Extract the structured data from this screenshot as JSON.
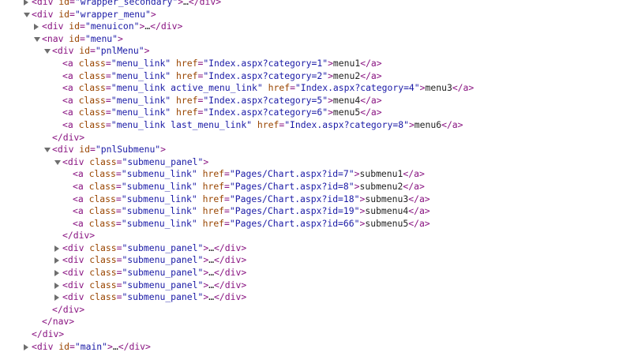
{
  "lines": [
    {
      "depth": 0,
      "toggle": "right",
      "parts": [
        {
          "t": "tag",
          "v": "<div "
        },
        {
          "t": "an",
          "v": "id"
        },
        {
          "t": "tag",
          "v": "="
        },
        {
          "t": "av",
          "v": "\"wrapper_secondary\""
        },
        {
          "t": "tag",
          "v": ">"
        },
        {
          "t": "ell",
          "v": "…"
        },
        {
          "t": "tag",
          "v": "</div>"
        }
      ]
    },
    {
      "depth": 0,
      "toggle": "down",
      "parts": [
        {
          "t": "tag",
          "v": "<div "
        },
        {
          "t": "an",
          "v": "id"
        },
        {
          "t": "tag",
          "v": "="
        },
        {
          "t": "av",
          "v": "\"wrapper_menu\""
        },
        {
          "t": "tag",
          "v": ">"
        }
      ]
    },
    {
      "depth": 1,
      "toggle": "right",
      "parts": [
        {
          "t": "tag",
          "v": "<div "
        },
        {
          "t": "an",
          "v": "id"
        },
        {
          "t": "tag",
          "v": "="
        },
        {
          "t": "av",
          "v": "\"menuicon\""
        },
        {
          "t": "tag",
          "v": ">"
        },
        {
          "t": "ell",
          "v": "…"
        },
        {
          "t": "tag",
          "v": "</div>"
        }
      ]
    },
    {
      "depth": 1,
      "toggle": "down",
      "parts": [
        {
          "t": "tag",
          "v": "<nav "
        },
        {
          "t": "an",
          "v": "id"
        },
        {
          "t": "tag",
          "v": "="
        },
        {
          "t": "av",
          "v": "\"menu\""
        },
        {
          "t": "tag",
          "v": ">"
        }
      ]
    },
    {
      "depth": 2,
      "toggle": "down",
      "parts": [
        {
          "t": "tag",
          "v": "<div "
        },
        {
          "t": "an",
          "v": "id"
        },
        {
          "t": "tag",
          "v": "="
        },
        {
          "t": "av",
          "v": "\"pnlMenu\""
        },
        {
          "t": "tag",
          "v": ">"
        }
      ]
    },
    {
      "depth": 3,
      "toggle": "none",
      "parts": [
        {
          "t": "tag",
          "v": "<a "
        },
        {
          "t": "an",
          "v": "class"
        },
        {
          "t": "tag",
          "v": "="
        },
        {
          "t": "av",
          "v": "\"menu_link\""
        },
        {
          "t": "tag",
          "v": " "
        },
        {
          "t": "an",
          "v": "href"
        },
        {
          "t": "tag",
          "v": "="
        },
        {
          "t": "avl",
          "v": "\"Index.aspx?category=1\""
        },
        {
          "t": "tag",
          "v": ">"
        },
        {
          "t": "txt",
          "v": "menu1"
        },
        {
          "t": "tag",
          "v": "</a>"
        }
      ]
    },
    {
      "depth": 3,
      "toggle": "none",
      "parts": [
        {
          "t": "tag",
          "v": "<a "
        },
        {
          "t": "an",
          "v": "class"
        },
        {
          "t": "tag",
          "v": "="
        },
        {
          "t": "av",
          "v": "\"menu_link\""
        },
        {
          "t": "tag",
          "v": " "
        },
        {
          "t": "an",
          "v": "href"
        },
        {
          "t": "tag",
          "v": "="
        },
        {
          "t": "avl",
          "v": "\"Index.aspx?category=2\""
        },
        {
          "t": "tag",
          "v": ">"
        },
        {
          "t": "txt",
          "v": "menu2"
        },
        {
          "t": "tag",
          "v": "</a>"
        }
      ]
    },
    {
      "depth": 3,
      "toggle": "none",
      "parts": [
        {
          "t": "tag",
          "v": "<a "
        },
        {
          "t": "an",
          "v": "class"
        },
        {
          "t": "tag",
          "v": "="
        },
        {
          "t": "av",
          "v": "\"menu_link active_menu_link\""
        },
        {
          "t": "tag",
          "v": " "
        },
        {
          "t": "an",
          "v": "href"
        },
        {
          "t": "tag",
          "v": "="
        },
        {
          "t": "avl",
          "v": "\"Index.aspx?category=4\""
        },
        {
          "t": "tag",
          "v": ">"
        },
        {
          "t": "txt",
          "v": "menu3"
        },
        {
          "t": "tag",
          "v": "</a>"
        }
      ]
    },
    {
      "depth": 3,
      "toggle": "none",
      "parts": [
        {
          "t": "tag",
          "v": "<a "
        },
        {
          "t": "an",
          "v": "class"
        },
        {
          "t": "tag",
          "v": "="
        },
        {
          "t": "av",
          "v": "\"menu_link\""
        },
        {
          "t": "tag",
          "v": " "
        },
        {
          "t": "an",
          "v": "href"
        },
        {
          "t": "tag",
          "v": "="
        },
        {
          "t": "avl",
          "v": "\"Index.aspx?category=5\""
        },
        {
          "t": "tag",
          "v": ">"
        },
        {
          "t": "txt",
          "v": "menu4"
        },
        {
          "t": "tag",
          "v": "</a>"
        }
      ]
    },
    {
      "depth": 3,
      "toggle": "none",
      "parts": [
        {
          "t": "tag",
          "v": "<a "
        },
        {
          "t": "an",
          "v": "class"
        },
        {
          "t": "tag",
          "v": "="
        },
        {
          "t": "av",
          "v": "\"menu_link\""
        },
        {
          "t": "tag",
          "v": " "
        },
        {
          "t": "an",
          "v": "href"
        },
        {
          "t": "tag",
          "v": "="
        },
        {
          "t": "avl",
          "v": "\"Index.aspx?category=6\""
        },
        {
          "t": "tag",
          "v": ">"
        },
        {
          "t": "txt",
          "v": "menu5"
        },
        {
          "t": "tag",
          "v": "</a>"
        }
      ]
    },
    {
      "depth": 3,
      "toggle": "none",
      "parts": [
        {
          "t": "tag",
          "v": "<a "
        },
        {
          "t": "an",
          "v": "class"
        },
        {
          "t": "tag",
          "v": "="
        },
        {
          "t": "av",
          "v": "\"menu_link last_menu_link\""
        },
        {
          "t": "tag",
          "v": " "
        },
        {
          "t": "an",
          "v": "href"
        },
        {
          "t": "tag",
          "v": "="
        },
        {
          "t": "avl",
          "v": "\"Index.aspx?category=8\""
        },
        {
          "t": "tag",
          "v": ">"
        },
        {
          "t": "txt",
          "v": "menu6"
        },
        {
          "t": "tag",
          "v": "</a>"
        }
      ]
    },
    {
      "depth": 2,
      "toggle": "none",
      "parts": [
        {
          "t": "tag",
          "v": "</div>"
        }
      ]
    },
    {
      "depth": 2,
      "toggle": "down",
      "parts": [
        {
          "t": "tag",
          "v": "<div "
        },
        {
          "t": "an",
          "v": "id"
        },
        {
          "t": "tag",
          "v": "="
        },
        {
          "t": "av",
          "v": "\"pnlSubmenu\""
        },
        {
          "t": "tag",
          "v": ">"
        }
      ]
    },
    {
      "depth": 3,
      "toggle": "down",
      "parts": [
        {
          "t": "tag",
          "v": "<div "
        },
        {
          "t": "an",
          "v": "class"
        },
        {
          "t": "tag",
          "v": "="
        },
        {
          "t": "av",
          "v": "\"submenu_panel\""
        },
        {
          "t": "tag",
          "v": ">"
        }
      ]
    },
    {
      "depth": 4,
      "toggle": "none",
      "parts": [
        {
          "t": "tag",
          "v": "<a "
        },
        {
          "t": "an",
          "v": "class"
        },
        {
          "t": "tag",
          "v": "="
        },
        {
          "t": "av",
          "v": "\"submenu_link\""
        },
        {
          "t": "tag",
          "v": " "
        },
        {
          "t": "an",
          "v": "href"
        },
        {
          "t": "tag",
          "v": "="
        },
        {
          "t": "avl",
          "v": "\"Pages/Chart.aspx?id=7\""
        },
        {
          "t": "tag",
          "v": ">"
        },
        {
          "t": "txt",
          "v": "submenu1"
        },
        {
          "t": "tag",
          "v": "</a>"
        }
      ]
    },
    {
      "depth": 4,
      "toggle": "none",
      "parts": [
        {
          "t": "tag",
          "v": "<a "
        },
        {
          "t": "an",
          "v": "class"
        },
        {
          "t": "tag",
          "v": "="
        },
        {
          "t": "av",
          "v": "\"submenu_link\""
        },
        {
          "t": "tag",
          "v": " "
        },
        {
          "t": "an",
          "v": "href"
        },
        {
          "t": "tag",
          "v": "="
        },
        {
          "t": "avl",
          "v": "\"Pages/Chart.aspx?id=8\""
        },
        {
          "t": "tag",
          "v": ">"
        },
        {
          "t": "txt",
          "v": "submenu2"
        },
        {
          "t": "tag",
          "v": "</a>"
        }
      ]
    },
    {
      "depth": 4,
      "toggle": "none",
      "parts": [
        {
          "t": "tag",
          "v": "<a "
        },
        {
          "t": "an",
          "v": "class"
        },
        {
          "t": "tag",
          "v": "="
        },
        {
          "t": "av",
          "v": "\"submenu_link\""
        },
        {
          "t": "tag",
          "v": " "
        },
        {
          "t": "an",
          "v": "href"
        },
        {
          "t": "tag",
          "v": "="
        },
        {
          "t": "avl",
          "v": "\"Pages/Chart.aspx?id=18\""
        },
        {
          "t": "tag",
          "v": ">"
        },
        {
          "t": "txt",
          "v": "submenu3"
        },
        {
          "t": "tag",
          "v": "</a>"
        }
      ]
    },
    {
      "depth": 4,
      "toggle": "none",
      "parts": [
        {
          "t": "tag",
          "v": "<a "
        },
        {
          "t": "an",
          "v": "class"
        },
        {
          "t": "tag",
          "v": "="
        },
        {
          "t": "av",
          "v": "\"submenu_link\""
        },
        {
          "t": "tag",
          "v": " "
        },
        {
          "t": "an",
          "v": "href"
        },
        {
          "t": "tag",
          "v": "="
        },
        {
          "t": "avl",
          "v": "\"Pages/Chart.aspx?id=19\""
        },
        {
          "t": "tag",
          "v": ">"
        },
        {
          "t": "txt",
          "v": "submenu4"
        },
        {
          "t": "tag",
          "v": "</a>"
        }
      ]
    },
    {
      "depth": 4,
      "toggle": "none",
      "parts": [
        {
          "t": "tag",
          "v": "<a "
        },
        {
          "t": "an",
          "v": "class"
        },
        {
          "t": "tag",
          "v": "="
        },
        {
          "t": "av",
          "v": "\"submenu_link\""
        },
        {
          "t": "tag",
          "v": " "
        },
        {
          "t": "an",
          "v": "href"
        },
        {
          "t": "tag",
          "v": "="
        },
        {
          "t": "avl",
          "v": "\"Pages/Chart.aspx?id=66\""
        },
        {
          "t": "tag",
          "v": ">"
        },
        {
          "t": "txt",
          "v": "submenu5"
        },
        {
          "t": "tag",
          "v": "</a>"
        }
      ]
    },
    {
      "depth": 3,
      "toggle": "none",
      "parts": [
        {
          "t": "tag",
          "v": "</div>"
        }
      ]
    },
    {
      "depth": 3,
      "toggle": "right",
      "parts": [
        {
          "t": "tag",
          "v": "<div "
        },
        {
          "t": "an",
          "v": "class"
        },
        {
          "t": "tag",
          "v": "="
        },
        {
          "t": "av",
          "v": "\"submenu_panel\""
        },
        {
          "t": "tag",
          "v": ">"
        },
        {
          "t": "ell",
          "v": "…"
        },
        {
          "t": "tag",
          "v": "</div>"
        }
      ]
    },
    {
      "depth": 3,
      "toggle": "right",
      "parts": [
        {
          "t": "tag",
          "v": "<div "
        },
        {
          "t": "an",
          "v": "class"
        },
        {
          "t": "tag",
          "v": "="
        },
        {
          "t": "av",
          "v": "\"submenu_panel\""
        },
        {
          "t": "tag",
          "v": ">"
        },
        {
          "t": "ell",
          "v": "…"
        },
        {
          "t": "tag",
          "v": "</div>"
        }
      ]
    },
    {
      "depth": 3,
      "toggle": "right",
      "parts": [
        {
          "t": "tag",
          "v": "<div "
        },
        {
          "t": "an",
          "v": "class"
        },
        {
          "t": "tag",
          "v": "="
        },
        {
          "t": "av",
          "v": "\"submenu_panel\""
        },
        {
          "t": "tag",
          "v": ">"
        },
        {
          "t": "ell",
          "v": "…"
        },
        {
          "t": "tag",
          "v": "</div>"
        }
      ]
    },
    {
      "depth": 3,
      "toggle": "right",
      "parts": [
        {
          "t": "tag",
          "v": "<div "
        },
        {
          "t": "an",
          "v": "class"
        },
        {
          "t": "tag",
          "v": "="
        },
        {
          "t": "av",
          "v": "\"submenu_panel\""
        },
        {
          "t": "tag",
          "v": ">"
        },
        {
          "t": "ell",
          "v": "…"
        },
        {
          "t": "tag",
          "v": "</div>"
        }
      ]
    },
    {
      "depth": 3,
      "toggle": "right",
      "parts": [
        {
          "t": "tag",
          "v": "<div "
        },
        {
          "t": "an",
          "v": "class"
        },
        {
          "t": "tag",
          "v": "="
        },
        {
          "t": "av",
          "v": "\"submenu_panel\""
        },
        {
          "t": "tag",
          "v": ">"
        },
        {
          "t": "ell",
          "v": "…"
        },
        {
          "t": "tag",
          "v": "</div>"
        }
      ]
    },
    {
      "depth": 2,
      "toggle": "none",
      "parts": [
        {
          "t": "tag",
          "v": "</div>"
        }
      ]
    },
    {
      "depth": 1,
      "toggle": "none",
      "parts": [
        {
          "t": "tag",
          "v": "</nav>"
        }
      ]
    },
    {
      "depth": 0,
      "toggle": "none",
      "parts": [
        {
          "t": "tag",
          "v": "</div>"
        }
      ]
    },
    {
      "depth": 0,
      "toggle": "right",
      "parts": [
        {
          "t": "tag",
          "v": "<div "
        },
        {
          "t": "an",
          "v": "id"
        },
        {
          "t": "tag",
          "v": "="
        },
        {
          "t": "av",
          "v": "\"main\""
        },
        {
          "t": "tag",
          "v": ">"
        },
        {
          "t": "ell",
          "v": "…"
        },
        {
          "t": "tag",
          "v": "</div>"
        }
      ]
    }
  ]
}
